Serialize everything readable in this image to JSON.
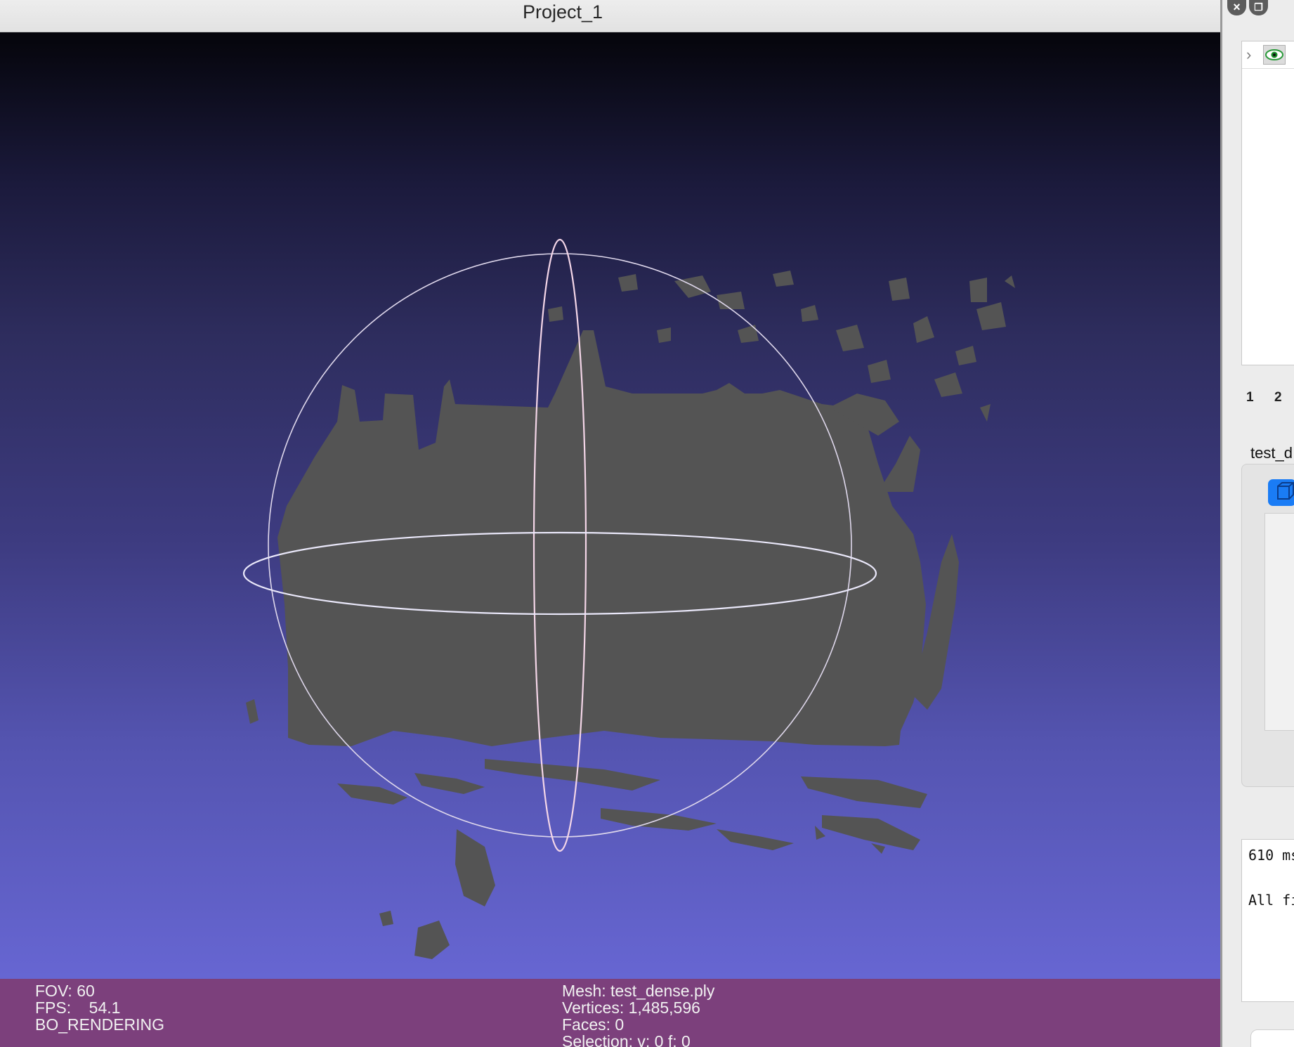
{
  "window": {
    "title": "Project_1"
  },
  "viewport": {
    "fov_label": "FOV: 60",
    "fps_label": "FPS:    54.1",
    "render_mode": "BO_RENDERING",
    "mesh_label": "Mesh: test_dense.ply",
    "vertices_label": "Vertices: 1,485,596",
    "faces_label": "Faces: 0",
    "selection_label": "Selection: v: 0 f: 0"
  },
  "panel": {
    "close_icon": "close-icon",
    "restore_icon": "restore-icon",
    "layer_expand_icon": "chevron-right-icon",
    "layer_visibility_icon": "eye-icon",
    "tabs": [
      "1",
      "2"
    ],
    "mesh_name_partial": "test_d",
    "log_lines": [
      "610 ms",
      "All fi"
    ]
  },
  "colors": {
    "info_bar": "#7d3e78",
    "point_cloud": "#545454",
    "trackball": "#f4d6e8",
    "accent": "#1a7cf5"
  }
}
